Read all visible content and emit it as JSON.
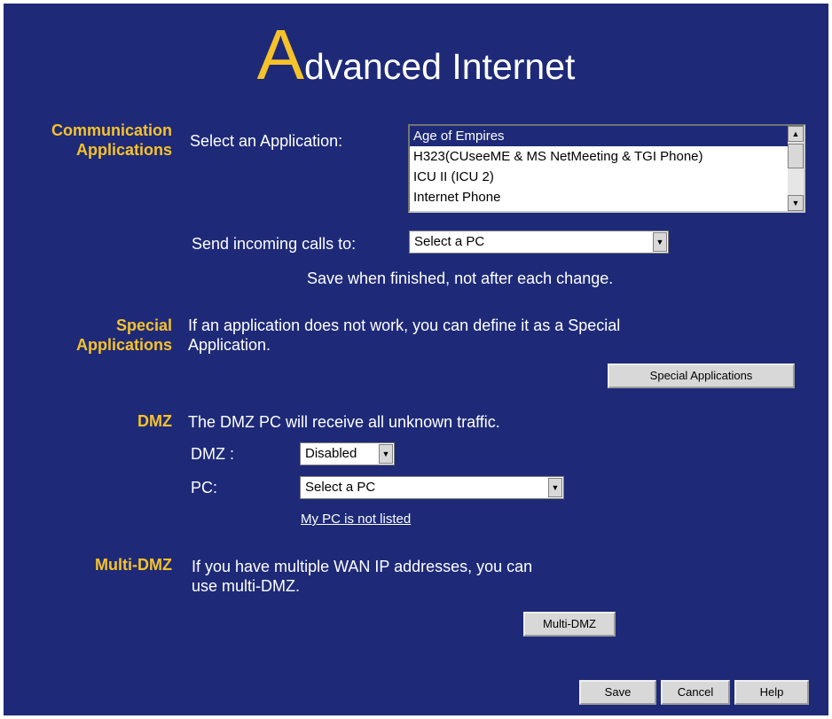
{
  "page": {
    "title_first_letter": "A",
    "title_rest": "dvanced Internet"
  },
  "communication": {
    "label_line1": "Communication",
    "label_line2": "Applications",
    "select_app_label": "Select an Application:",
    "applications": [
      "Age of Empires",
      "H323(CUseeME & MS NetMeeting & TGI Phone)",
      "ICU II (ICU 2)",
      "Internet Phone"
    ],
    "selected_application": "Age of Empires",
    "send_calls_label": "Send incoming calls to:",
    "send_calls_value": "Select a PC",
    "save_note": "Save when finished, not after each change."
  },
  "special": {
    "label_line1": "Special",
    "label_line2": "Applications",
    "desc_line1": "If an application does not work, you can define it as a Special",
    "desc_line2": "Application.",
    "button_label": "Special Applications"
  },
  "dmz": {
    "label": "DMZ",
    "desc": "The DMZ PC will receive all unknown traffic.",
    "dmz_field_label": "DMZ :",
    "dmz_value": "Disabled",
    "pc_field_label": "PC:",
    "pc_value": "Select a PC",
    "not_listed_link": "My PC is not listed"
  },
  "multidmz": {
    "label": "Multi-DMZ",
    "desc_line1": "If you have multiple WAN IP addresses, you can",
    "desc_line2": "use multi-DMZ.",
    "button_label": "Multi-DMZ"
  },
  "footer": {
    "save_label": "Save",
    "cancel_label": "Cancel",
    "help_label": "Help"
  },
  "icons": {
    "scroll_up": "scroll-up-arrow",
    "scroll_down": "scroll-down-arrow",
    "dropdown": "dropdown-arrow"
  },
  "colors": {
    "background": "#1e2a78",
    "section_label": "#f6c22a",
    "text": "#ffffff"
  }
}
